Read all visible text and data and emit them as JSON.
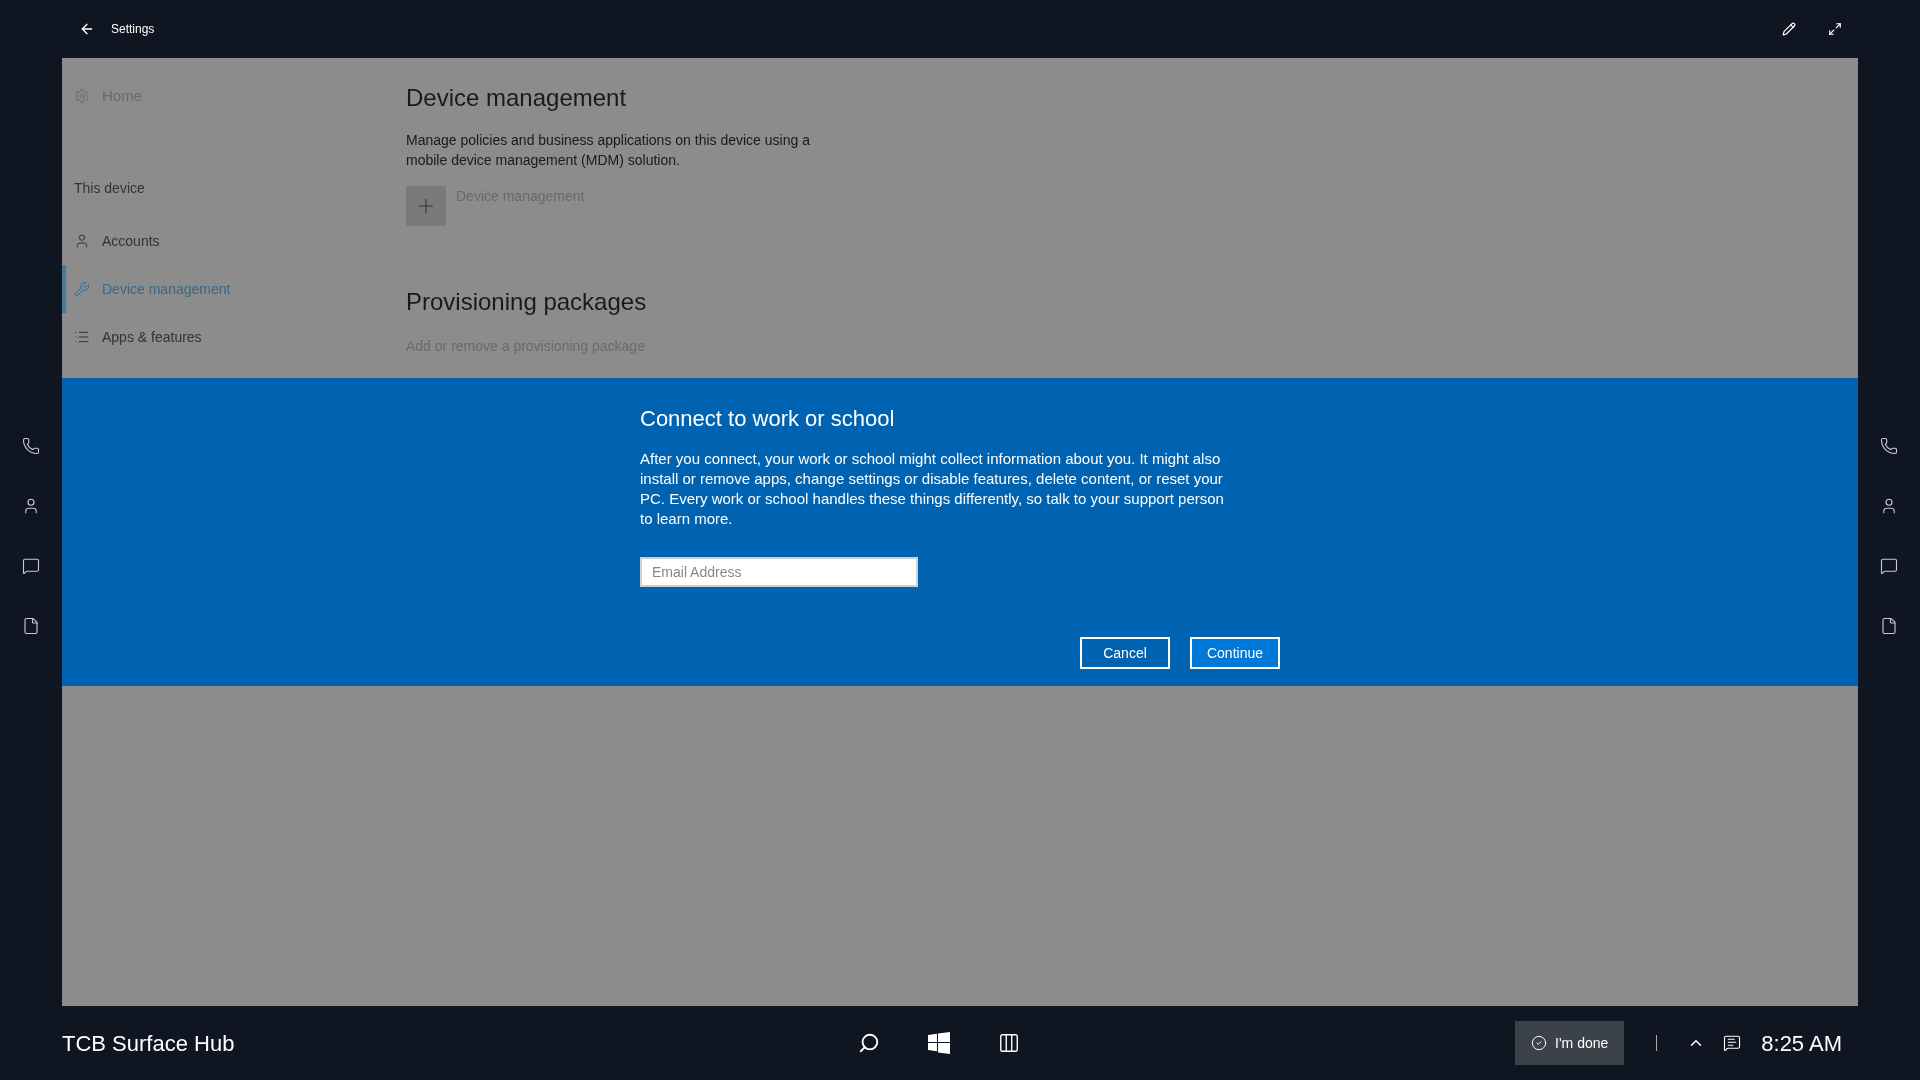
{
  "title_bar": {
    "title": "Settings"
  },
  "sidebar": {
    "home": "Home",
    "section": "This device",
    "items": [
      {
        "label": "Accounts",
        "selected": false
      },
      {
        "label": "Device management",
        "selected": true
      },
      {
        "label": "Apps & features",
        "selected": false
      }
    ]
  },
  "content": {
    "title": "Device management",
    "description": "Manage policies and business applications on this device using a mobile device management (MDM) solution.",
    "add_label": "Device management",
    "section2_title": "Provisioning packages",
    "section2_link": "Add or remove a provisioning package"
  },
  "dialog": {
    "title": "Connect to work or school",
    "body": "After you connect, your work or school might collect information about you. It might also install or remove apps, change settings or disable features, delete content, or reset your PC. Every work or school handles these things differently, so talk to your support person to learn more.",
    "email": {
      "placeholder": "Email Address"
    },
    "buttons": [
      {
        "label": "Cancel",
        "default": false
      },
      {
        "label": "Continue",
        "default": true
      }
    ]
  },
  "taskbar": {
    "device_name": "TCB Surface Hub",
    "done_button": "I'm done",
    "time": "8:25 AM"
  }
}
